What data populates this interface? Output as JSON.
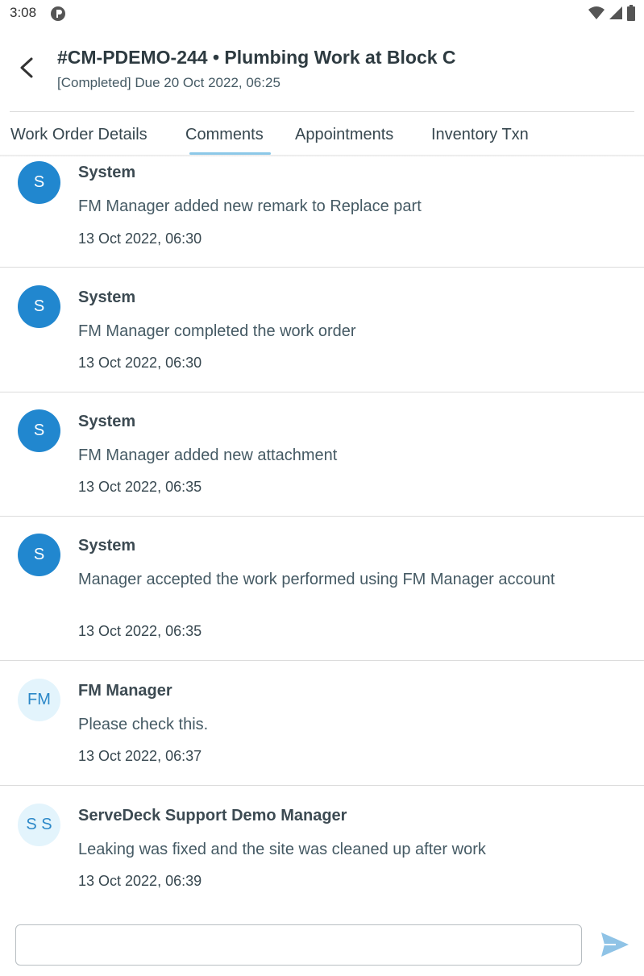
{
  "status_bar": {
    "time": "3:08"
  },
  "header": {
    "title": "#CM-PDEMO-244 • Plumbing Work at Block C",
    "subtitle": "[Completed] Due 20 Oct 2022, 06:25"
  },
  "tabs": [
    {
      "label": "Work Order Details"
    },
    {
      "label": "Comments",
      "selected": true
    },
    {
      "label": "Appointments"
    },
    {
      "label": "Inventory Txn"
    }
  ],
  "comments": [
    {
      "avatar": "S",
      "author": "System",
      "message": "FM Manager added new remark to Replace part",
      "time": "13 Oct 2022, 06:30"
    },
    {
      "avatar": "S",
      "author": "System",
      "message": "FM Manager completed the work order",
      "time": "13 Oct 2022, 06:30"
    },
    {
      "avatar": "S",
      "author": "System",
      "message": "FM Manager added new attachment",
      "time": "13 Oct 2022, 06:35"
    },
    {
      "avatar": "S",
      "author": "System",
      "message": "Manager accepted the work performed using FM Manager account",
      "time": "13 Oct 2022, 06:35"
    },
    {
      "avatar": "FM",
      "author": "FM Manager",
      "message": "Please check this.",
      "time": "13 Oct 2022, 06:37"
    },
    {
      "avatar": "S S",
      "author": "ServeDeck Support Demo Manager",
      "message": "Leaking was fixed and the site was cleaned up after work",
      "time": "13 Oct 2022, 06:39"
    }
  ],
  "composer": {
    "value": "",
    "placeholder": ""
  },
  "colors": {
    "system_avatar": "#2187cf",
    "user_avatar_bg": "#e3f4fc",
    "tab_indicator": "#8cc8e8",
    "send_icon": "#8fc3e6"
  }
}
